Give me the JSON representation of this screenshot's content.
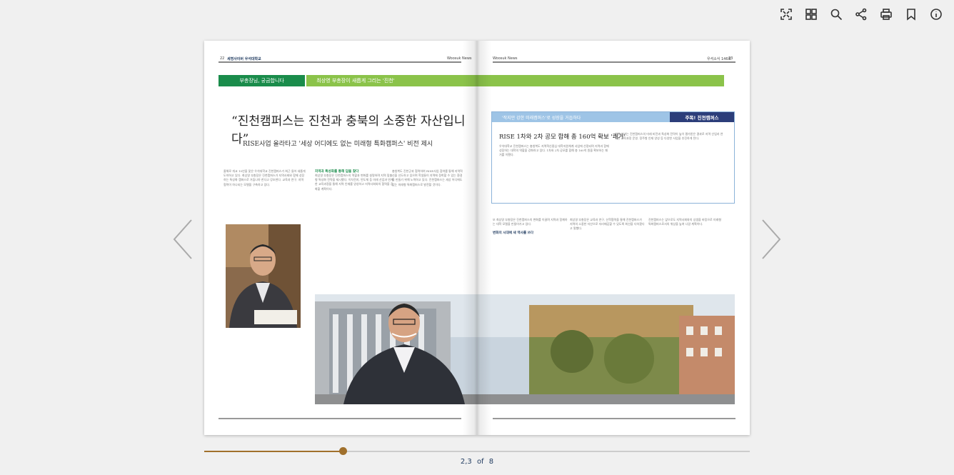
{
  "toolbar": {
    "icons": [
      "fullscreen-icon",
      "thumbnails-icon",
      "search-icon",
      "share-icon",
      "print-icon",
      "bookmark-icon",
      "info-icon"
    ]
  },
  "left_page": {
    "header_left": "22",
    "header_brand": "세명사이버 우석대학교",
    "header_right": "Woosuk News",
    "tag_green": "부총장님, 궁금합니다",
    "tag_lime": "최상영 부총장이 새롭게 그리는 '진천'",
    "headline": "“진천캠퍼스는 진천과 충북의 소중한 자산입니다”",
    "subhead": "RISE사업 올라타고 '세상 어디에도 없는 미래형 특화캠퍼스' 비전 제시",
    "col1_text": "올해로 개교 10년을 맞은 우석대학교 진천캠퍼스가 최근 들어 새롭게 도약하고 있다. 최상영 부총장은 진천캠퍼스가 지역사회와 함께 성장하는 특성화 캠퍼스로 거듭나야 한다고 강조한다. 교육과 연구, 지역협력이 하나되는 모델을 구축하고 있다.",
    "col2_heading": "지역과 특성화를 통해 답을 찾다",
    "col2_text": "최상영 부총장은 진천캠퍼스의 역할과 변화를 설명하며 지역 맞춤형 특성화 전략을 제시했다. 이차전지, 반도체 등 미래 산업과 연계한 교육과정을 통해 지역 인재를 양성하고 지역사회와의 협력을 강화할 계획이다.",
    "col3_text": "충청북도 진천군과 협력하여 RISE사업 참여를 통해 지역혁신을 선도하고 있으며 학생들이 지역에 정착할 수 있는 환경을 만들기 위해 노력하고 있다. 진천캠퍼스는 세상 어디에도 없는 미래형 특화캠퍼스로 발전할 것이다."
  },
  "right_page": {
    "header_left": "Woosuk News",
    "header_right": "우석소식 146호",
    "header_page": "23",
    "box_bar_left": "'작지만 강한 미래캠퍼스'로 성장을 거듭하다",
    "box_bar_right": "주목! 진천캠퍼스",
    "box_title": "RISE 1차와 2차 공모 합해 총 160억 확보 '쾌거'",
    "box_col1": "우석대학교 진천캠퍼스는 충청북도 지역혁신중심 대학지원체계 사업에 선정되며 지역과 함께 성장하는 대학의 역할을 강화하고 있다. 1차와 2차 공모를 합해 총 160억 원을 확보하는 쾌거를 이뤘다.",
    "box_col2": "이번 성과는 진천캠퍼스의 미래 비전과 특성화 전략이 높이 평가받은 결과로 지역 산업과 연계한 교육과정 운영, 정주형 인재 양성 등 다양한 사업을 추진하게 된다.",
    "col1_text": "또 최상영 부총장은 진천캠퍼스의 변화를 이끌며 지역과 함께하는 대학 모델을 만들어가고 있다.",
    "col1_heading": "변화의 시대에 새 역사를 쓰다",
    "col2_text": "최상영 부총장은 교육과 연구, 산학협력을 통해 진천캠퍼스가 지역의 소중한 자산으로 자리매김할 수 있도록 최선을 다하겠다고 말했다.",
    "col3_text": "진천캠퍼스는 앞으로도 지역사회와의 상생을 바탕으로 미래형 특화캠퍼스로서의 위상을 높여 나갈 계획이다."
  },
  "viewer": {
    "current_pages": "2,3",
    "of_label": "of",
    "total_pages": "8",
    "progress_fraction": 0.254
  }
}
